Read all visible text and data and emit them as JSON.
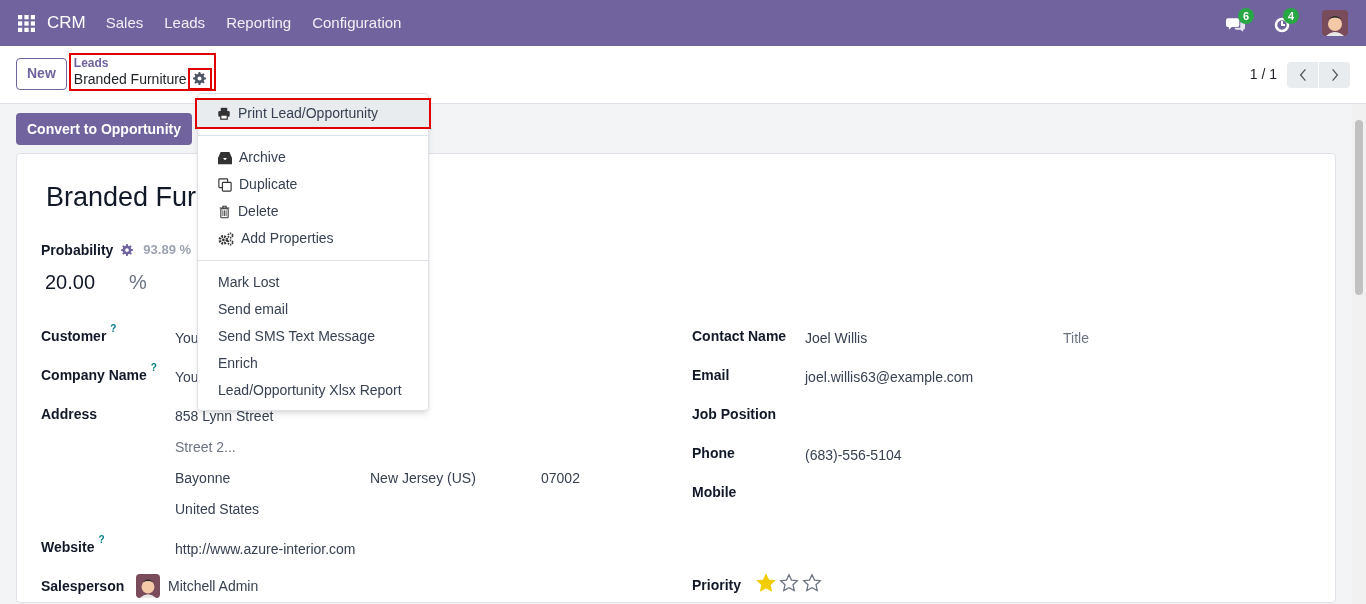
{
  "navbar": {
    "app": "CRM",
    "menu": [
      "Sales",
      "Leads",
      "Reporting",
      "Configuration"
    ],
    "messages_count": "6",
    "activities_count": "4"
  },
  "control_panel": {
    "new_button": "New",
    "breadcrumb": "Leads",
    "record_name": "Branded Furniture",
    "breadcrumb_highlighted": true,
    "gear_highlighted": true,
    "pager": "1 / 1"
  },
  "action_menu": {
    "sections": [
      [
        {
          "kind": "print",
          "label": "Print Lead/Opportunity",
          "selected": true,
          "highlighted": true
        }
      ],
      [
        {
          "kind": "archive",
          "label": "Archive",
          "selected": false,
          "highlighted": false
        },
        {
          "kind": "duplicate",
          "label": "Duplicate",
          "selected": false,
          "highlighted": false
        },
        {
          "kind": "delete",
          "label": "Delete",
          "selected": false,
          "highlighted": false
        },
        {
          "kind": "properties",
          "label": "Add Properties",
          "selected": false,
          "highlighted": false
        }
      ],
      [
        {
          "kind": "plain",
          "label": "Mark Lost",
          "selected": false,
          "highlighted": false
        },
        {
          "kind": "plain",
          "label": "Send email",
          "selected": false,
          "highlighted": false
        },
        {
          "kind": "plain",
          "label": "Send SMS Text Message",
          "selected": false,
          "highlighted": false
        },
        {
          "kind": "plain",
          "label": "Enrich",
          "selected": false,
          "highlighted": false
        },
        {
          "kind": "plain",
          "label": "Lead/Opportunity Xlsx Report",
          "selected": false,
          "highlighted": false
        }
      ]
    ]
  },
  "convert_button": "Convert to Opportunity",
  "form": {
    "title": "Branded Fur",
    "probability": {
      "label": "Probability",
      "automated": "93.89 %",
      "value": "20.00",
      "unit": "%"
    },
    "left": {
      "customer": {
        "label": "Customer",
        "help": "?",
        "value": "You"
      },
      "company": {
        "label": "Company Name",
        "help": "?",
        "value": "You"
      },
      "address": {
        "label": "Address",
        "street": "858 Lynn Street",
        "street2_placeholder": "Street 2...",
        "city": "Bayonne",
        "state": "New Jersey (US)",
        "zip": "07002",
        "country": "United States"
      },
      "website": {
        "label": "Website",
        "help": "?",
        "value": "http://www.azure-interior.com"
      },
      "salesperson": {
        "label": "Salesperson",
        "value": "Mitchell Admin"
      }
    },
    "right": {
      "contact": {
        "label": "Contact Name",
        "value": "Joel Willis",
        "title_placeholder": "Title"
      },
      "email": {
        "label": "Email",
        "value": "joel.willis63@example.com"
      },
      "job": {
        "label": "Job Position"
      },
      "phone": {
        "label": "Phone",
        "value": "(683)-556-5104"
      },
      "mobile": {
        "label": "Mobile"
      },
      "priority": {
        "label": "Priority",
        "stars": 1
      }
    }
  }
}
